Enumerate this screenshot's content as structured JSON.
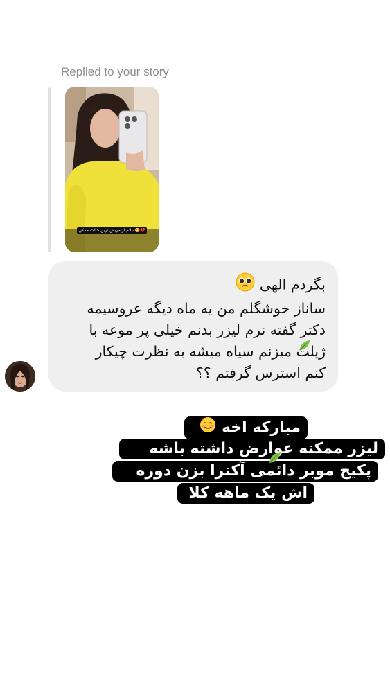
{
  "reply_header": {
    "text": "Replied to your story"
  },
  "story": {
    "caption": "سلام از مریض ترین حالت ممکن🥲💔"
  },
  "message": {
    "line1": "بگردم الهی",
    "line2": "ساناز خوشگلم من یه ماه دیگه عروسیمه",
    "line3": "دکتر گفته نرم لیزر بدنم خیلی پر موعه با",
    "line4": "ژیلت میزنم سیاه میشه به نظرت چیکار",
    "line5": "کنم استرس گرفتم ؟؟",
    "emoji": "pleading-face-icon"
  },
  "response": {
    "line1": "مبارکه اخه",
    "line2": "لیزر ممکنه عوارض داشته باشه",
    "line3": "پکیج موبر دائمی آکنرا بزن دوره",
    "line4": "اش یک ماهه کلا",
    "emoji": "smiling-face-with-hearts-icon",
    "leaf_icon": "leaf-icon"
  }
}
